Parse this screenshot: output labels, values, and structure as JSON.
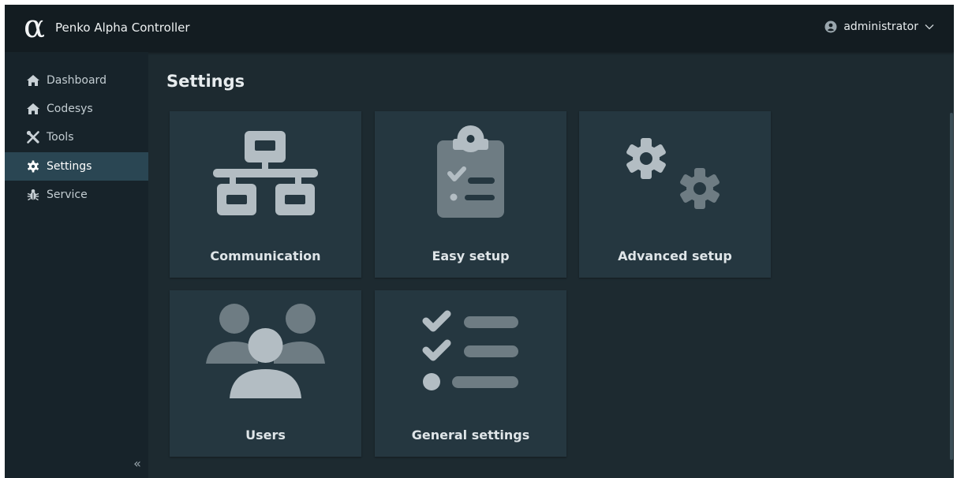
{
  "app": {
    "title": "Penko Alpha Controller",
    "logo_glyph": "α"
  },
  "user": {
    "name": "administrator",
    "icon": "user-circle-icon",
    "chevron_icon": "chevron-down-icon"
  },
  "sidebar": {
    "items": [
      {
        "label": "Dashboard",
        "icon": "home-icon",
        "active": false
      },
      {
        "label": "Codesys",
        "icon": "home-icon",
        "active": false
      },
      {
        "label": "Tools",
        "icon": "tools-icon",
        "active": false
      },
      {
        "label": "Settings",
        "icon": "gear-icon",
        "active": true
      },
      {
        "label": "Service",
        "icon": "bug-icon",
        "active": false
      }
    ],
    "collapse_glyph": "«"
  },
  "page": {
    "title": "Settings"
  },
  "tiles": [
    {
      "label": "Communication",
      "icon": "network-icon"
    },
    {
      "label": "Easy setup",
      "icon": "clipboard-checklist-icon"
    },
    {
      "label": "Advanced setup",
      "icon": "gears-icon"
    },
    {
      "label": "Users",
      "icon": "users-icon"
    },
    {
      "label": "General settings",
      "icon": "checklist-icon"
    }
  ],
  "colors": {
    "topbar": "#131c21",
    "sidebar": "#17232a",
    "active_item": "#2a4653",
    "background": "#1d2a30",
    "tile": "#253740",
    "icon_light": "#b3bdc3",
    "icon_dark": "#6e7c83"
  }
}
